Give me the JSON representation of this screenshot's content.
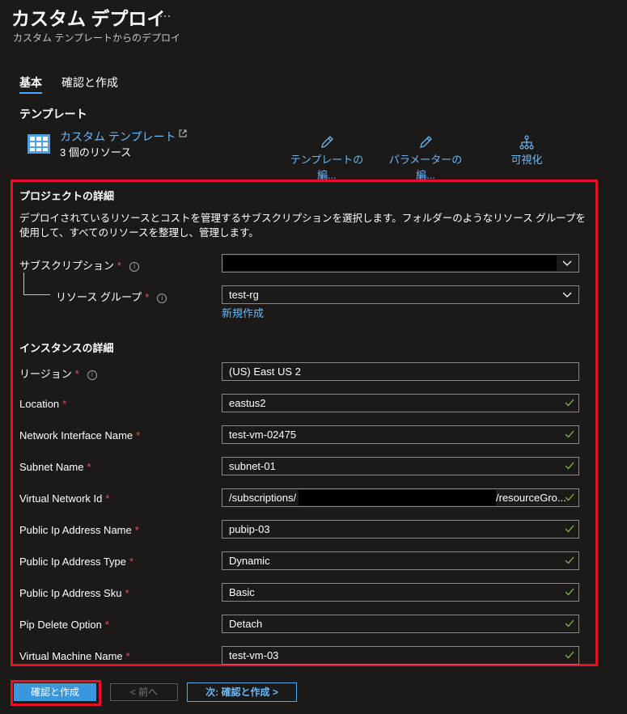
{
  "header": {
    "title": "カスタム デプロイ",
    "more": "…",
    "subtitle": "カスタム テンプレートからのデプロイ"
  },
  "tabs": [
    {
      "label": "基本"
    },
    {
      "label": "確認と作成"
    }
  ],
  "template": {
    "heading": "テンプレート",
    "name": "カスタム テンプレート",
    "count": "3 個のリソース",
    "actions": {
      "edit_template": "テンプレートの編...",
      "edit_params": "パラメーターの編...",
      "visualize": "可視化"
    }
  },
  "project": {
    "heading": "プロジェクトの詳細",
    "description": "デプロイされているリソースとコストを管理するサブスクリプションを選択します。フォルダーのようなリソース グループを使用して、すべてのリソースを整理し、管理します。",
    "subscription": {
      "label": "サブスクリプション",
      "value": ""
    },
    "resource_group": {
      "label": "リソース グループ",
      "value": "test-rg"
    },
    "create_new": "新規作成"
  },
  "instance": {
    "heading": "インスタンスの詳細",
    "region": {
      "label": "リージョン",
      "value": "(US) East US 2"
    },
    "fields": [
      {
        "label": "Location",
        "value": "eastus2"
      },
      {
        "label": "Network Interface Name",
        "value": "test-vm-02475"
      },
      {
        "label": "Subnet Name",
        "value": "subnet-01"
      },
      {
        "label": "Virtual Network Id",
        "value": "/subscriptions/",
        "value_suffix": "/resourceGro..."
      },
      {
        "label": "Public Ip Address Name",
        "value": "pubip-03"
      },
      {
        "label": "Public Ip Address Type",
        "value": "Dynamic"
      },
      {
        "label": "Public Ip Address Sku",
        "value": "Basic"
      },
      {
        "label": "Pip Delete Option",
        "value": "Detach"
      },
      {
        "label": "Virtual Machine Name",
        "value": "test-vm-03"
      }
    ]
  },
  "required_mark": "*",
  "info_mark": "i",
  "footer": {
    "review_create": "確認と作成",
    "prev": "< 前へ",
    "next": "次: 確認と作成 >"
  },
  "colors": {
    "accent": "#3a96dd",
    "link": "#6cb8f6",
    "required": "#e8505b",
    "valid": "#8fbf4a",
    "highlight": "#e81123"
  }
}
